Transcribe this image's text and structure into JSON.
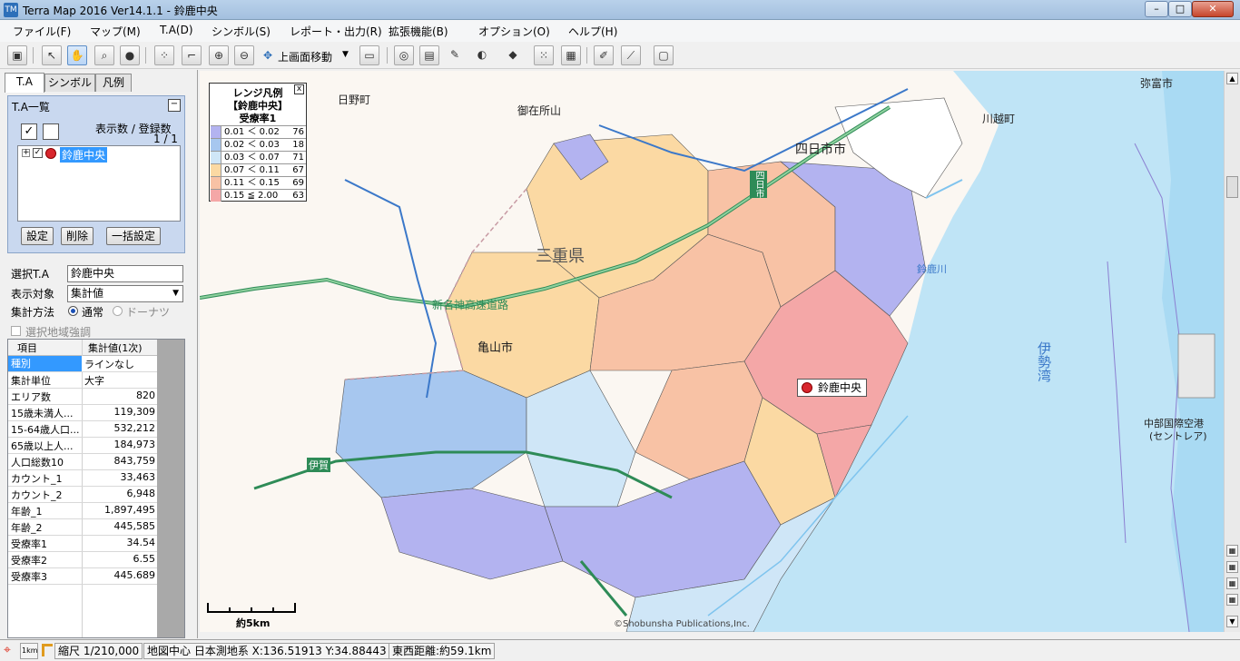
{
  "window": {
    "title": "Terra Map 2016 Ver14.1.1 - 鈴鹿中央",
    "min": "–",
    "max": "□",
    "close": "✕"
  },
  "menu": [
    "ファイル(F)",
    "マップ(M)",
    "T.A(D)",
    "シンボル(S)",
    "レポート・出力(R)",
    "拡張機能(B)",
    "オプション(O)",
    "ヘルプ(H)"
  ],
  "toolbar": {
    "move_label": "上画面移動"
  },
  "left": {
    "tabs": [
      "T.A",
      "シンボル",
      "凡例"
    ],
    "ta_group_title": "T.A一覧",
    "count_header": "表示数 / 登録数",
    "count_value": "1 / 1",
    "ta_item": "鈴鹿中央",
    "buttons": {
      "settings": "設定",
      "delete": "削除",
      "bulk": "一括設定"
    },
    "selected_ta_label": "選択T.A",
    "selected_ta_value": "鈴鹿中央",
    "display_target_label": "表示対象",
    "display_target_value": "集計値",
    "agg_method_label": "集計方法",
    "agg_normal": "通常",
    "agg_donut": "ドーナツ",
    "highlight_label": "選択地域強調",
    "table_headers": [
      "項目",
      "集計値(1次)"
    ],
    "table_rows": [
      [
        "種別",
        "ラインなし"
      ],
      [
        "集計単位",
        "大字"
      ],
      [
        "エリア数",
        "820"
      ],
      [
        "15歳未満人...",
        "119,309"
      ],
      [
        "15-64歳人口...",
        "532,212"
      ],
      [
        "65歳以上人...",
        "184,973"
      ],
      [
        "人口総数10",
        "843,759"
      ],
      [
        "カウント_1",
        "33,463"
      ],
      [
        "カウント_2",
        "6,948"
      ],
      [
        "年齢_1",
        "1,897,495"
      ],
      [
        "年齢_2",
        "445,585"
      ],
      [
        "受療率1",
        "34.54"
      ],
      [
        "受療率2",
        "6.55"
      ],
      [
        "受療率3",
        "445.689"
      ]
    ]
  },
  "legend": {
    "title1": "レンジ凡例",
    "title2": "【鈴鹿中央】",
    "title3": "受療率1",
    "close": "x",
    "rows": [
      {
        "color": "#b3b3f0",
        "range": "0.01 ＜ 0.02",
        "count": "76"
      },
      {
        "color": "#a7c7ef",
        "range": "0.02 ＜ 0.03",
        "count": "18"
      },
      {
        "color": "#cfe6f7",
        "range": "0.03 ＜ 0.07",
        "count": "71"
      },
      {
        "color": "#fbd9a3",
        "range": "0.07 ＜ 0.11",
        "count": "67"
      },
      {
        "color": "#f8c2a5",
        "range": "0.11 ＜ 0.15",
        "count": "69"
      },
      {
        "color": "#f4a7a7",
        "range": "0.15 ≦ 2.00",
        "count": "63"
      }
    ]
  },
  "map": {
    "labels": {
      "hino": "日野町",
      "gozaisho": "御在所山",
      "yokkaichi": "四日市市",
      "kawagoe": "川越町",
      "yatomi": "弥富市",
      "mie": "三重県",
      "shinmeishin": "新名神高速道路",
      "kameyama": "亀山市",
      "ise_bay": "伊勢湾",
      "airport1": "中部国際空港",
      "airport2": "(セントレア)",
      "iga": "伊賀",
      "yokkaichi_v": "四日市",
      "suzuka_river": "鈴鹿川",
      "copyright": "©Shobunsha Publications,Inc."
    },
    "poi_label": "鈴鹿中央",
    "scale_label": "約5km"
  },
  "status": {
    "scale": "縮尺 1/210,000",
    "center": "地図中心 日本測地系 X:136.51913 Y:34.88443",
    "distance": "東西距離:約59.1km",
    "unit": "1km"
  }
}
